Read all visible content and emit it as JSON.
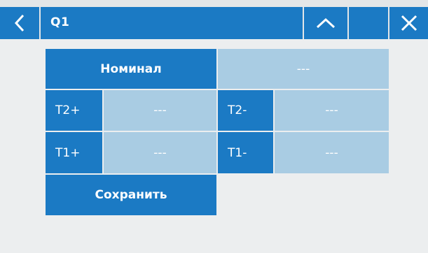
{
  "header": {
    "back_icon": "chevron-left-icon",
    "title": "Q1",
    "up_icon": "chevron-up-icon",
    "close_icon": "close-icon"
  },
  "form": {
    "nominal_label": "Номинал",
    "nominal_value": "---",
    "t2_plus_label": "T2+",
    "t2_plus_value": "---",
    "t2_minus_label": "T2-",
    "t2_minus_value": "---",
    "t1_plus_label": "T1+",
    "t1_plus_value": "---",
    "t1_minus_label": "T1-",
    "t1_minus_value": "---",
    "save_label": "Сохранить"
  },
  "colors": {
    "accent": "#1b7ac4",
    "field": "#a9cce3",
    "background": "#eceeef"
  }
}
